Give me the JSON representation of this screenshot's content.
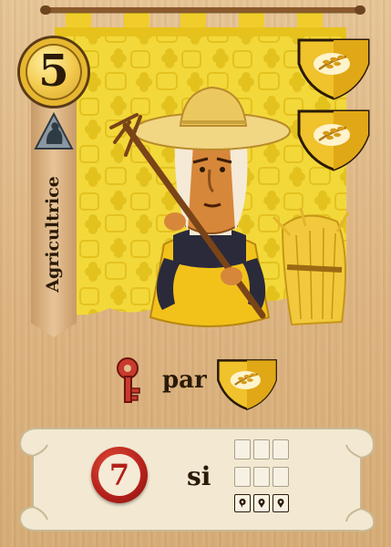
{
  "card": {
    "cost": "5",
    "role": "Agricultrice",
    "ability_word": "par",
    "condition_word": "si",
    "reward": "7"
  },
  "colors": {
    "banner_yellow": "#f2d533",
    "shield_gold": "#f0c22b",
    "seal_red": "#b4201a",
    "wood": "#e2bd8c",
    "ink": "#2a1a08"
  },
  "icons": {
    "cost": "gold-coin-icon",
    "role_symbol": "farmer-silhouette-icon",
    "guild_shield_1": "wheat-shield-icon",
    "guild_shield_2": "wheat-shield-icon",
    "ability_key": "key-icon",
    "ability_target": "wheat-shield-icon",
    "reward_seal": "wax-seal-icon",
    "condition_grid": "building-grid-icon"
  }
}
